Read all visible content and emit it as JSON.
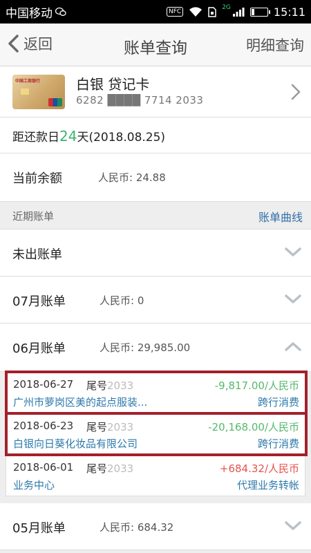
{
  "status": {
    "carrier": "中国移动",
    "nfc": "NFC",
    "net": "2G",
    "time": "15:11"
  },
  "nav": {
    "back_label": "返回",
    "title": "账单查询",
    "right_label": "明细查询"
  },
  "card": {
    "bank_name_on_card": "中国工商银行",
    "name": "白银 贷记卡",
    "number": "6282 ████ 7714 2033"
  },
  "due": {
    "prefix": "距还款日",
    "days": "24",
    "suffix": "天(2018.08.25)"
  },
  "balance": {
    "label": "当前余额",
    "value": "人民币: 24.88"
  },
  "recent": {
    "label": "近期账单",
    "link": "账单曲线"
  },
  "months": [
    {
      "label": "未出账单",
      "amount": "",
      "expanded": false
    },
    {
      "label": "07月账单",
      "amount": "人民币: 0",
      "expanded": false
    },
    {
      "label": "06月账单",
      "amount": "人民币: 29,985.00",
      "expanded": true
    },
    {
      "label": "05月账单",
      "amount": "人民币: 684.32",
      "expanded": false
    }
  ],
  "transactions": [
    {
      "date": "2018-06-27",
      "tail_label": "尾号",
      "tail": "2033",
      "amount": "-9,817.00/人民币",
      "merchant": "广州市萝岗区美的起点服装...",
      "type": "跨行消费",
      "amount_color": "#55b86e",
      "highlighted": true
    },
    {
      "date": "2018-06-23",
      "tail_label": "尾号",
      "tail": "2033",
      "amount": "-20,168.00/人民币",
      "merchant": "白银向日葵化妆品有限公司",
      "type": "跨行消费",
      "amount_color": "#55b86e",
      "highlighted": true
    },
    {
      "date": "2018-06-01",
      "tail_label": "尾号",
      "tail": "2033",
      "amount": "+684.32/人民币",
      "merchant": "业务中心",
      "type": "代理业务转帐",
      "amount_color": "#e2534f",
      "highlighted": false
    }
  ],
  "colors": {
    "highlight_border": "#a3202a",
    "link": "#2f6fa8",
    "due_days": "#3bb36c"
  }
}
